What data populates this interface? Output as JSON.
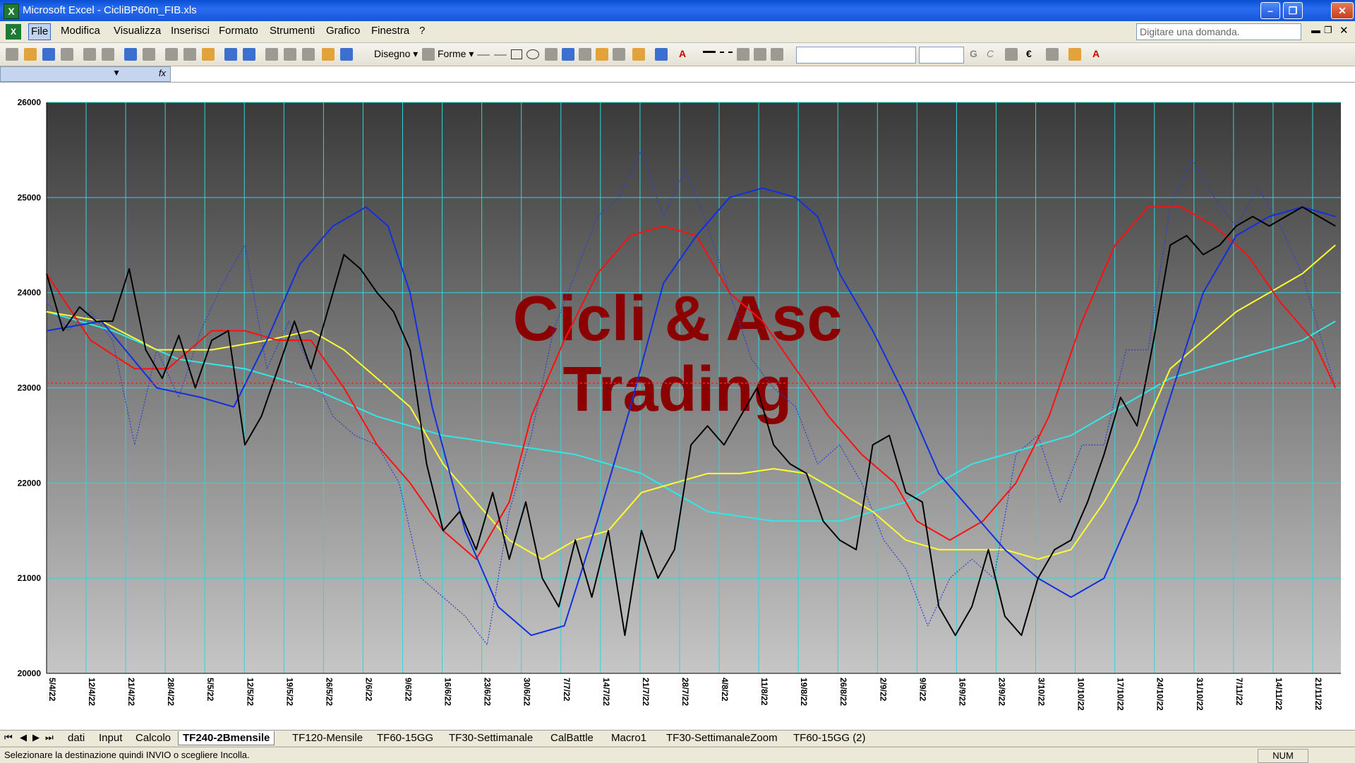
{
  "window": {
    "title": "Microsoft Excel - CicliBP60m_FIB.xls"
  },
  "menu": [
    "File",
    "Modifica",
    "Visualizza",
    "Inserisci",
    "Formato",
    "Strumenti",
    "Grafico",
    "Finestra",
    "?"
  ],
  "help_box": {
    "placeholder": "Digitare una domanda."
  },
  "toolbar": {
    "draw_label": "Disegno",
    "shapes_label": "Forme",
    "font_bold": "G",
    "font_italic": "C",
    "currency": "€"
  },
  "formula": {
    "fx": "fx"
  },
  "sheet_tabs": [
    "dati",
    "Input",
    "Calcolo",
    "TF240-2Bmensile",
    "TF120-Mensile",
    "TF60-15GG",
    "TF30-Settimanale",
    "CalBattle",
    "Macro1",
    "TF30-SettimanaleZoom",
    "TF60-15GG (2)"
  ],
  "active_tab": "TF240-2Bmensile",
  "status": {
    "message": "Selezionare la destinazione quindi INVIO o scegliere Incolla.",
    "num": "NUM"
  },
  "colors": {
    "price": "#000000",
    "dotted": "#2a3fd0",
    "blue": "#1030e0",
    "red": "#ff1010",
    "yellow": "#ffff30",
    "cyan": "#30e8e8",
    "watermark": "#8b0000",
    "grid": "#2fd6d6"
  },
  "chart_data": {
    "type": "line",
    "title": "",
    "watermark": [
      "Cicli & Asc",
      "Trading"
    ],
    "ylim": [
      20000,
      26000
    ],
    "yticks": [
      20000,
      21000,
      22000,
      23000,
      24000,
      25000,
      26000
    ],
    "ytick_labels": [
      "20000",
      "21000",
      "22000",
      "23000",
      "24000",
      "25000",
      "26000"
    ],
    "xlim": [
      0,
      235
    ],
    "x_labels": [
      "5/4/22",
      "12/4/22",
      "21/4/22",
      "28/4/22",
      "5/5/22",
      "12/5/22",
      "19/5/22",
      "26/5/22",
      "2/6/22",
      "9/6/22",
      "16/6/22",
      "23/6/22",
      "30/6/22",
      "7/7/22",
      "14/7/22",
      "21/7/22",
      "28/7/22",
      "4/8/22",
      "11/8/22",
      "19/8/22",
      "26/8/22",
      "2/9/22",
      "9/9/22",
      "16/9/22",
      "23/9/22",
      "3/10/22",
      "10/10/22",
      "17/10/22",
      "24/10/22",
      "31/10/22",
      "7/11/22",
      "14/11/22",
      "21/11/22"
    ],
    "reference_line": 23050,
    "series": [
      {
        "key": "price",
        "style": "solid",
        "x": [
          0,
          3,
          6,
          9,
          12,
          15,
          18,
          21,
          24,
          27,
          30,
          33,
          36,
          39,
          42,
          45,
          48,
          51,
          54,
          57,
          60,
          63,
          66,
          69,
          72,
          75,
          78,
          81,
          84,
          87,
          90,
          93,
          96,
          99,
          102,
          105,
          108,
          111,
          114,
          117,
          120,
          123,
          126,
          129,
          132,
          135,
          138,
          141,
          144,
          147,
          150,
          153,
          156,
          159,
          162,
          165,
          168,
          171,
          174,
          177,
          180,
          183,
          186,
          189,
          192,
          195,
          198,
          201,
          204,
          207,
          210,
          213,
          216,
          219,
          222,
          225,
          228,
          231,
          234
        ],
        "values": [
          24200,
          23600,
          23850,
          23700,
          23700,
          24250,
          23400,
          23100,
          23550,
          23000,
          23500,
          23600,
          22400,
          22700,
          23200,
          23700,
          23200,
          23800,
          24400,
          24250,
          24000,
          23800,
          23400,
          22200,
          21500,
          21700,
          21300,
          21900,
          21200,
          21800,
          21000,
          20700,
          21400,
          20800,
          21500,
          20400,
          21500,
          21000,
          21300,
          22400,
          22600,
          22400,
          22700,
          23000,
          22400,
          22200,
          22100,
          21600,
          21400,
          21300,
          22400,
          22500,
          21900,
          21800,
          20700,
          20400,
          20700,
          21300,
          20600,
          20400,
          21000,
          21300,
          21400,
          21800,
          22300,
          22900,
          22600,
          23500,
          24500,
          24600,
          24400,
          24500,
          24700,
          24800,
          24700,
          24800,
          24900,
          24800,
          24700
        ]
      },
      {
        "key": "dotted",
        "style": "dotted",
        "x": [
          0,
          4,
          8,
          12,
          16,
          20,
          24,
          28,
          32,
          36,
          40,
          44,
          48,
          52,
          56,
          60,
          64,
          68,
          72,
          76,
          80,
          84,
          88,
          92,
          96,
          100,
          104,
          108,
          112,
          116,
          120,
          124,
          128,
          132,
          136,
          140,
          144,
          148,
          152,
          156,
          160,
          164,
          168,
          172,
          176,
          180,
          184,
          188,
          192,
          196,
          200,
          204,
          208,
          212,
          216,
          220,
          224,
          228,
          232,
          234
        ],
        "values": [
          23900,
          23600,
          23800,
          23500,
          22400,
          23400,
          22900,
          23600,
          24100,
          24500,
          23200,
          23700,
          23200,
          22700,
          22500,
          22400,
          22000,
          21000,
          20800,
          20600,
          20300,
          21700,
          22500,
          23600,
          24200,
          24800,
          25000,
          25500,
          24800,
          25300,
          24700,
          24000,
          23300,
          23000,
          22800,
          22200,
          22400,
          22000,
          21400,
          21100,
          20500,
          21000,
          21200,
          21000,
          22300,
          22500,
          21800,
          22400,
          22400,
          23400,
          23400,
          24900,
          25400,
          25000,
          24700,
          25100,
          24700,
          24200,
          23400,
          23000
        ]
      },
      {
        "key": "blue",
        "style": "solid",
        "x": [
          0,
          10,
          20,
          28,
          34,
          40,
          46,
          52,
          58,
          62,
          66,
          70,
          76,
          82,
          88,
          94,
          100,
          106,
          112,
          118,
          124,
          130,
          136,
          140,
          144,
          150,
          156,
          162,
          168,
          174,
          180,
          186,
          192,
          198,
          204,
          210,
          216,
          222,
          228,
          234
        ],
        "values": [
          23600,
          23700,
          23000,
          22900,
          22800,
          23500,
          24300,
          24700,
          24900,
          24700,
          24000,
          22800,
          21500,
          20700,
          20400,
          20500,
          21600,
          22800,
          24100,
          24600,
          25000,
          25100,
          25000,
          24800,
          24200,
          23600,
          22900,
          22100,
          21700,
          21300,
          21000,
          20800,
          21000,
          21800,
          22900,
          24000,
          24600,
          24800,
          24900,
          24800
        ]
      },
      {
        "key": "red",
        "style": "solid",
        "x": [
          0,
          8,
          16,
          22,
          30,
          36,
          42,
          48,
          54,
          60,
          66,
          72,
          78,
          84,
          88,
          94,
          100,
          106,
          112,
          118,
          124,
          130,
          136,
          142,
          148,
          154,
          158,
          164,
          170,
          176,
          182,
          188,
          194,
          200,
          206,
          212,
          218,
          224,
          230,
          234
        ],
        "values": [
          24200,
          23500,
          23200,
          23200,
          23600,
          23600,
          23500,
          23500,
          23000,
          22400,
          22000,
          21500,
          21200,
          21800,
          22700,
          23500,
          24200,
          24600,
          24700,
          24600,
          24000,
          23700,
          23200,
          22700,
          22300,
          22000,
          21600,
          21400,
          21600,
          22000,
          22700,
          23700,
          24500,
          24900,
          24900,
          24700,
          24400,
          23900,
          23500,
          23000
        ]
      },
      {
        "key": "yellow",
        "style": "solid",
        "x": [
          0,
          10,
          20,
          30,
          40,
          48,
          54,
          60,
          66,
          72,
          78,
          84,
          90,
          96,
          102,
          108,
          114,
          120,
          126,
          132,
          138,
          144,
          150,
          156,
          162,
          168,
          174,
          180,
          186,
          192,
          198,
          204,
          210,
          216,
          222,
          228,
          234
        ],
        "values": [
          23800,
          23700,
          23400,
          23400,
          23500,
          23600,
          23400,
          23100,
          22800,
          22200,
          21800,
          21400,
          21200,
          21400,
          21500,
          21900,
          22000,
          22100,
          22100,
          22150,
          22100,
          21900,
          21700,
          21400,
          21300,
          21300,
          21300,
          21200,
          21300,
          21800,
          22400,
          23200,
          23500,
          23800,
          24000,
          24200,
          24500
        ]
      },
      {
        "key": "cyan",
        "style": "solid",
        "x": [
          0,
          12,
          24,
          36,
          48,
          60,
          72,
          84,
          96,
          108,
          114,
          120,
          126,
          132,
          138,
          144,
          150,
          156,
          162,
          168,
          174,
          180,
          186,
          192,
          198,
          204,
          210,
          216,
          222,
          228,
          234
        ],
        "values": [
          23800,
          23600,
          23300,
          23200,
          23000,
          22700,
          22500,
          22400,
          22300,
          22100,
          21900,
          21700,
          21650,
          21600,
          21600,
          21600,
          21700,
          21800,
          22000,
          22200,
          22300,
          22400,
          22500,
          22700,
          22900,
          23100,
          23200,
          23300,
          23400,
          23500,
          23700
        ]
      }
    ]
  }
}
